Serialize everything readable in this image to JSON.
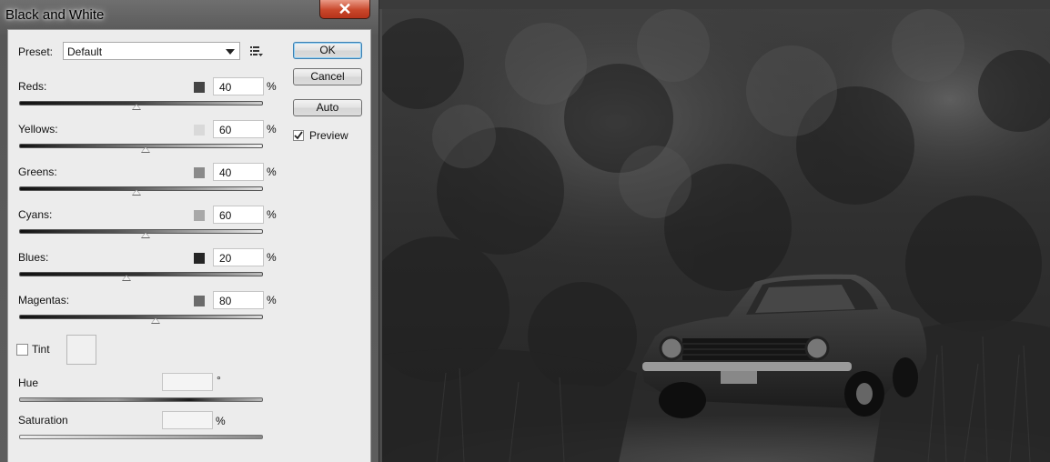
{
  "dialog": {
    "title": "Black and White",
    "close_glyph": "✕",
    "preset": {
      "label": "Preset:",
      "value": "Default"
    },
    "buttons": {
      "ok": "OK",
      "cancel": "Cancel",
      "auto": "Auto"
    },
    "preview": {
      "label": "Preview",
      "checked": true
    },
    "sliders": [
      {
        "label": "Reds:",
        "value": "40",
        "unit": "%",
        "swatch": "#444444",
        "thumb_fraction": 0.48
      },
      {
        "label": "Yellows:",
        "value": "60",
        "unit": "%",
        "swatch": "#d9d9d9",
        "thumb_fraction": 0.52
      },
      {
        "label": "Greens:",
        "value": "40",
        "unit": "%",
        "swatch": "#8a8a8a",
        "thumb_fraction": 0.48
      },
      {
        "label": "Cyans:",
        "value": "60",
        "unit": "%",
        "swatch": "#a8a8a8",
        "thumb_fraction": 0.52
      },
      {
        "label": "Blues:",
        "value": "20",
        "unit": "%",
        "swatch": "#252525",
        "thumb_fraction": 0.44
      },
      {
        "label": "Magentas:",
        "value": "80",
        "unit": "%",
        "swatch": "#6b6b6b",
        "thumb_fraction": 0.56
      }
    ],
    "tint": {
      "label": "Tint",
      "checked": false
    },
    "hue": {
      "label": "Hue",
      "unit": "°",
      "value": ""
    },
    "saturation": {
      "label": "Saturation",
      "unit": "%",
      "value": ""
    }
  },
  "colors": {
    "ok_border": "#3c7fb1",
    "close_red": "#c9472b"
  },
  "icons": {
    "close": "close-icon",
    "preset_menu": "preset-menu-icon",
    "dropdown": "chevron-down-icon",
    "check": "check-icon"
  }
}
